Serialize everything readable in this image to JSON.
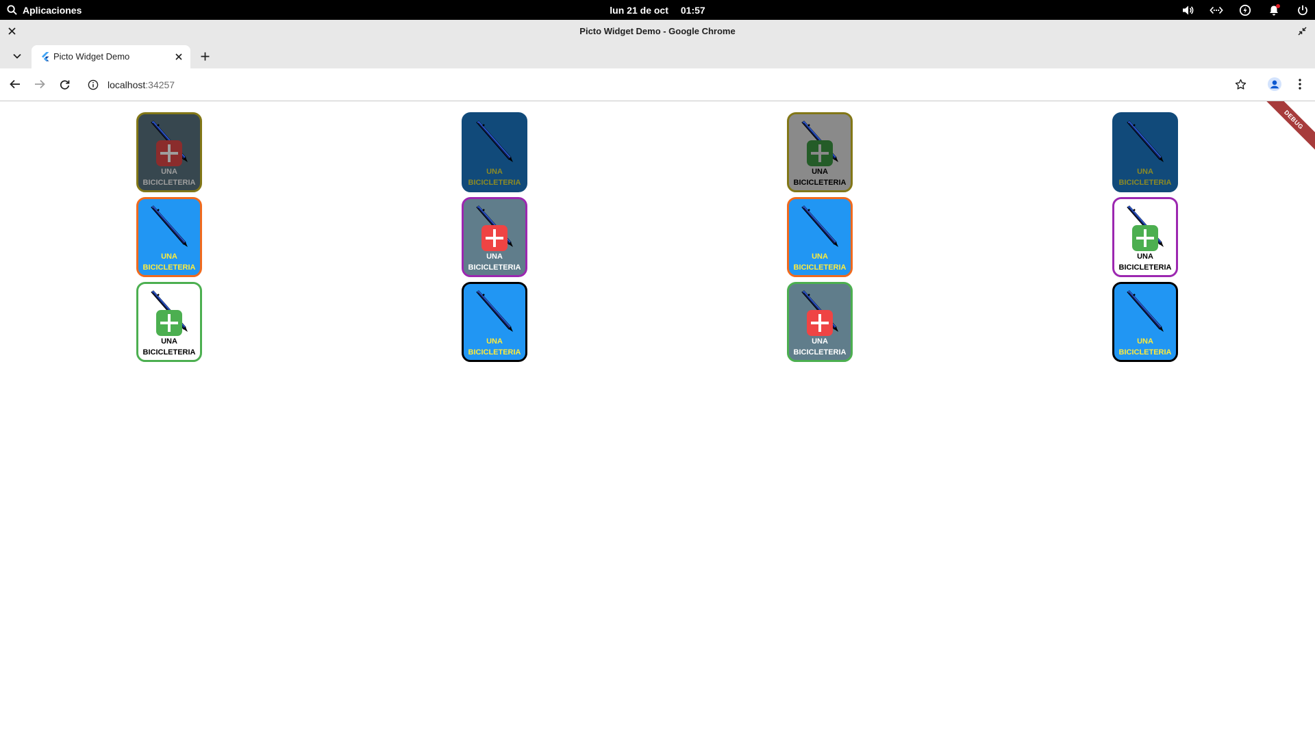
{
  "topbar": {
    "apps_label": "Aplicaciones",
    "date": "lun 21 de oct",
    "time": "01:57"
  },
  "window": {
    "title": "Picto Widget Demo - Google Chrome"
  },
  "tab": {
    "title": "Picto Widget Demo"
  },
  "address": {
    "host": "localhost",
    "port": ":34257"
  },
  "debug_banner": "DEBUG",
  "pictos": [
    {
      "label": "UNA BICICLETERIA",
      "bg": "#37474f",
      "border": "#827717",
      "text": "#9e9e9e",
      "plus": true,
      "plus_bg": "#8b2c2c",
      "plus_fg": "#9e9e9e"
    },
    {
      "label": "UNA BICICLETERIA",
      "bg": "#2196f3",
      "border": "#f06a1e",
      "text": "#ffeb3b",
      "plus": false
    },
    {
      "label": "UNA BICICLETERIA",
      "bg": "#ffffff",
      "border": "#4caf50",
      "text": "#000000",
      "plus": true,
      "plus_bg": "#4caf50",
      "plus_fg": "#ffffff"
    },
    {
      "label": "UNA BICICLETERIA",
      "bg": "#114a7a",
      "border": "#114a7a",
      "text": "#8c8a25",
      "plus": false
    },
    {
      "label": "UNA BICICLETERIA",
      "bg": "#607d8b",
      "border": "#9c27b0",
      "text": "#ffffff",
      "plus": true,
      "plus_bg": "#ef4444",
      "plus_fg": "#ffffff"
    },
    {
      "label": "UNA BICICLETERIA",
      "bg": "#2196f3",
      "border": "#000000",
      "text": "#ffeb3b",
      "plus": false
    },
    {
      "label": "UNA BICICLETERIA",
      "bg": "#8a8a8a",
      "border": "#827717",
      "text": "#000000",
      "plus": true,
      "plus_bg": "#245c28",
      "plus_fg": "#8a8a8a"
    },
    {
      "label": "UNA BICICLETERIA",
      "bg": "#2196f3",
      "border": "#f06a1e",
      "text": "#ffeb3b",
      "plus": false
    },
    {
      "label": "UNA BICICLETERIA",
      "bg": "#607d8b",
      "border": "#4caf50",
      "text": "#ffffff",
      "plus": true,
      "plus_bg": "#ef4444",
      "plus_fg": "#ffffff"
    },
    {
      "label": "UNA BICICLETERIA",
      "bg": "#114a7a",
      "border": "#114a7a",
      "text": "#8c8a25",
      "plus": false
    },
    {
      "label": "UNA BICICLETERIA",
      "bg": "#ffffff",
      "border": "#9c27b0",
      "text": "#000000",
      "plus": true,
      "plus_bg": "#4caf50",
      "plus_fg": "#ffffff"
    },
    {
      "label": "UNA BICICLETERIA",
      "bg": "#2196f3",
      "border": "#000000",
      "text": "#ffeb3b",
      "plus": false
    }
  ]
}
